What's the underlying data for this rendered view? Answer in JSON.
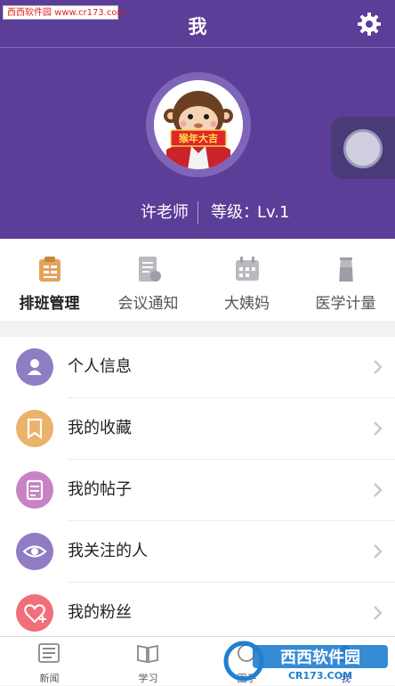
{
  "watermark_top": "西西软件园 www.cr173.com",
  "header": {
    "title": "我"
  },
  "profile": {
    "name": "许老师",
    "level_label": "等级：",
    "level_value": "Lv.1",
    "avatar_banner": "猴年大吉"
  },
  "quick_actions": [
    {
      "label": "排班管理",
      "icon": "clipboard-icon"
    },
    {
      "label": "会议通知",
      "icon": "document-icon"
    },
    {
      "label": "大姨妈",
      "icon": "calendar-icon"
    },
    {
      "label": "医学计量",
      "icon": "measuring-cup-icon"
    }
  ],
  "menu": [
    {
      "label": "个人信息",
      "icon": "person-icon",
      "color": "#8f7cc2"
    },
    {
      "label": "我的收藏",
      "icon": "bookmark-icon",
      "color": "#ebb26a"
    },
    {
      "label": "我的帖子",
      "icon": "note-icon",
      "color": "#c883c4"
    },
    {
      "label": "我关注的人",
      "icon": "eye-icon",
      "color": "#8f7cc2"
    },
    {
      "label": "我的粉丝",
      "icon": "heart-plus-icon",
      "color": "#ef6f7a"
    }
  ],
  "tabs": [
    {
      "label": "新闻",
      "icon": "news-icon"
    },
    {
      "label": "学习",
      "icon": "book-icon"
    },
    {
      "label": "圈子",
      "icon": "circle-icon"
    },
    {
      "label": "我",
      "icon": "me-icon"
    }
  ],
  "watermark_bottom": {
    "brand": "西西软件园",
    "url": "CR173.COM"
  },
  "colors": {
    "header": "#5b3e98",
    "accent": "#5b3e98",
    "quick_icon_active": "#e3a35c",
    "quick_icon_inactive": "#b9b9bf",
    "chevron": "#c8c8c8"
  }
}
